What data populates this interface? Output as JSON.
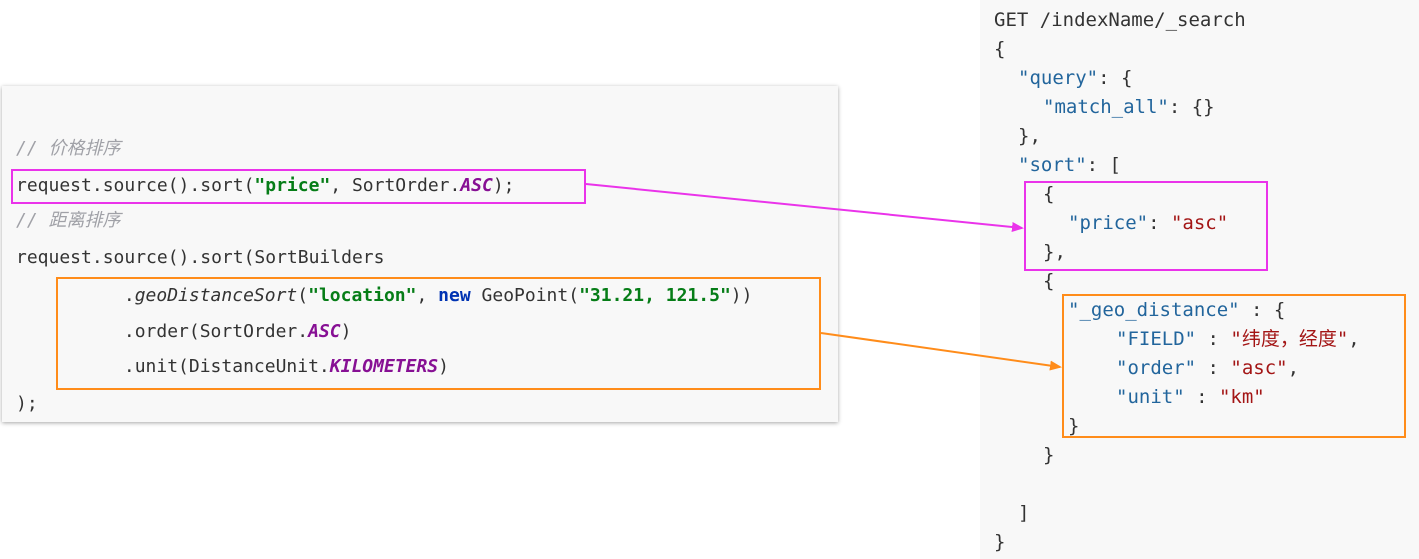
{
  "java_code": {
    "comment_price": "// 价格排序",
    "price_prefix": "request.source().sort(",
    "price_string": "\"price\"",
    "price_middle": ", SortOrder.",
    "price_constant": "ASC",
    "price_suffix": ");",
    "comment_distance": "// 距离排序",
    "distance_line1": "request.source().sort(SortBuilders",
    "geo_indent": "       .",
    "geo_method": "geoDistanceSort",
    "geo_paren": "(",
    "geo_location": "\"location\"",
    "geo_comma": ", ",
    "geo_new": "new",
    "geo_point": " GeoPoint(",
    "geo_coords": "\"31.21, 121.5\"",
    "geo_close": "))",
    "order_prefix": "       .order(SortOrder.",
    "order_constant": "ASC",
    "order_suffix": ")",
    "unit_prefix": "       .unit(DistanceUnit.",
    "unit_constant": "KILOMETERS",
    "unit_suffix": ")",
    "close_line": ");"
  },
  "dsl_code": {
    "line1": "GET /indexName/_search",
    "line2": "{",
    "query_key": "\"query\"",
    "query_open": ": {",
    "match_all_key": "\"match_all\"",
    "match_all_rest": ": {}",
    "query_close": "},",
    "sort_key": "\"sort\"",
    "sort_open": ": [",
    "obj1_open": "{",
    "price_key": "\"price\"",
    "price_colon": ": ",
    "price_val": "\"asc\"",
    "obj1_close": "},",
    "obj2_open": "{",
    "geo_key": "\"_geo_distance\"",
    "geo_open": " : {",
    "field_key": "\"FIELD\"",
    "field_colon": " : ",
    "field_val": "\"纬度，经度\"",
    "field_comma": ",",
    "order_key": "\"order\"",
    "order_colon": " : ",
    "order_val": "\"asc\"",
    "order_comma": ",",
    "unit_key": "\"unit\"",
    "unit_colon": " : ",
    "unit_val": "\"km\"",
    "geo_close": "}",
    "obj2_close": "}",
    "sort_close": "]",
    "root_close": "}"
  },
  "colors": {
    "highlight_price": "#ea33ea",
    "highlight_geo": "#ff8c1a"
  }
}
